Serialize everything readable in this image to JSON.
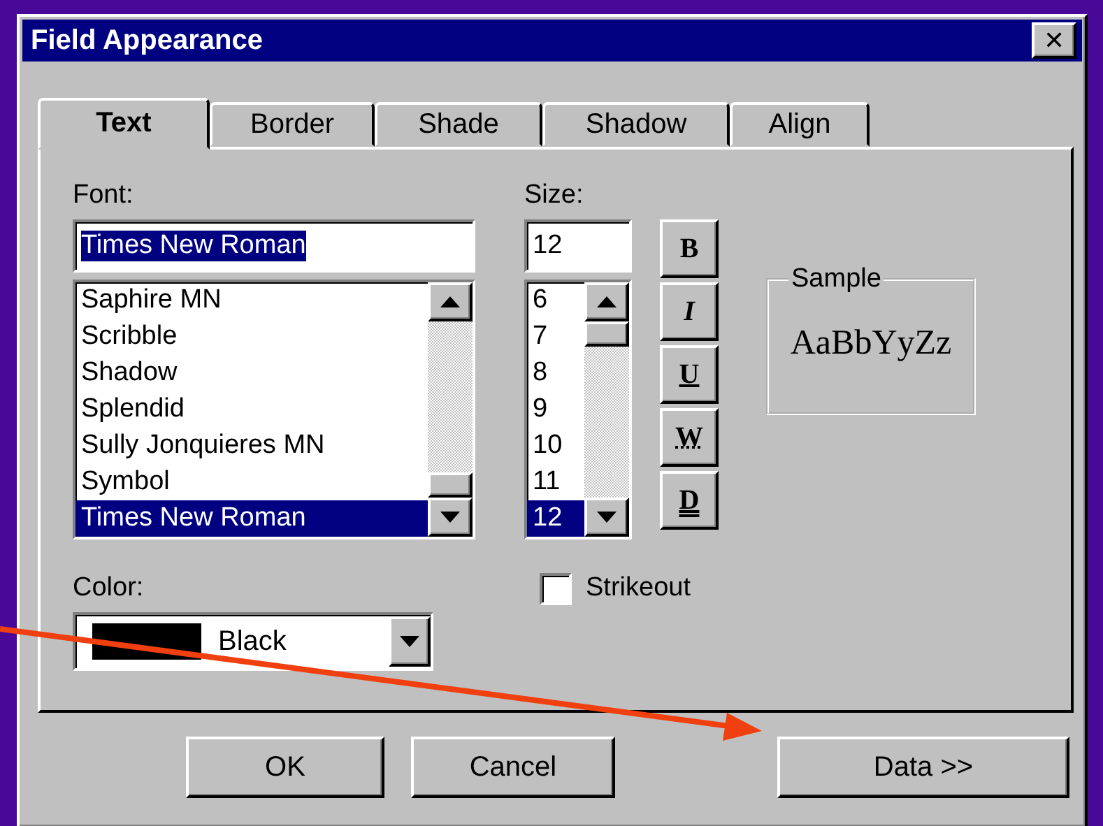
{
  "window": {
    "title": "Field Appearance",
    "close": "✕"
  },
  "tabs": [
    {
      "label": "Text",
      "selected": true
    },
    {
      "label": "Border",
      "selected": false
    },
    {
      "label": "Shade",
      "selected": false
    },
    {
      "label": "Shadow",
      "selected": false
    },
    {
      "label": "Align",
      "selected": false
    }
  ],
  "font": {
    "label": "Font:",
    "value": "Times New Roman",
    "items": [
      {
        "label": "Saphire MN",
        "selected": false
      },
      {
        "label": "Scribble",
        "selected": false
      },
      {
        "label": "Shadow",
        "selected": false
      },
      {
        "label": "Splendid",
        "selected": false
      },
      {
        "label": "Sully Jonquieres MN",
        "selected": false
      },
      {
        "label": "Symbol",
        "selected": false
      },
      {
        "label": "Times New Roman",
        "selected": true
      }
    ]
  },
  "size": {
    "label": "Size:",
    "value": "12",
    "items": [
      {
        "label": "6",
        "selected": false
      },
      {
        "label": "7",
        "selected": false
      },
      {
        "label": "8",
        "selected": false
      },
      {
        "label": "9",
        "selected": false
      },
      {
        "label": "10",
        "selected": false
      },
      {
        "label": "11",
        "selected": false
      },
      {
        "label": "12",
        "selected": true
      }
    ]
  },
  "style_buttons": [
    {
      "label": "B",
      "kind": "bold"
    },
    {
      "label": "I",
      "kind": "italic"
    },
    {
      "label": "U",
      "kind": "underline"
    },
    {
      "label": "W",
      "kind": "word"
    },
    {
      "label": "D",
      "kind": "double"
    }
  ],
  "sample": {
    "label": "Sample",
    "text": "AaBbYyZz"
  },
  "color": {
    "label": "Color:",
    "value": "Black",
    "color": "#000000"
  },
  "strikeout": {
    "label": "Strikeout",
    "checked": false
  },
  "buttons": [
    {
      "label": "OK",
      "kind": "ok"
    },
    {
      "label": "Cancel",
      "kind": "cancel"
    },
    {
      "label": "Data >>",
      "kind": "data"
    }
  ]
}
